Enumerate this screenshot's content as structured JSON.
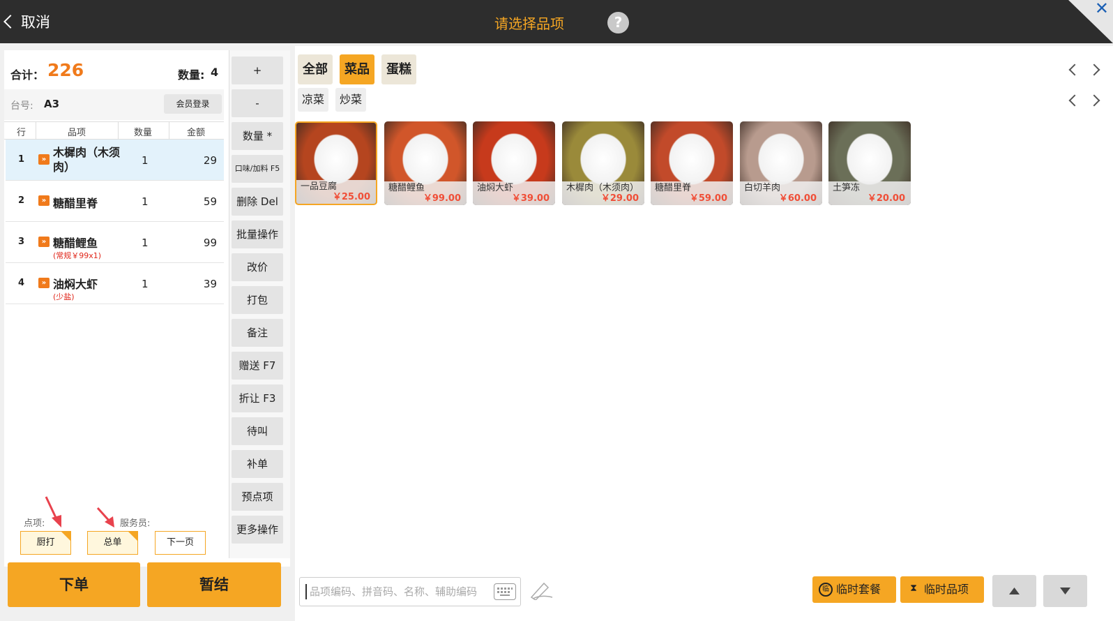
{
  "header": {
    "cancel_label": "取消",
    "title": "请选择品项",
    "help_label": "?",
    "close_label": "✕"
  },
  "summary": {
    "total_label": "合计：",
    "total_value": "226",
    "qty_label": "数量:",
    "qty_value": "4",
    "table_label": "台号:",
    "table_value": "A3",
    "member_login": "会员登录"
  },
  "order_columns": [
    "行",
    "品项",
    "数量",
    "金额"
  ],
  "order_rows": [
    {
      "idx": "1",
      "tag": "»",
      "name": "木樨肉（木须肉）",
      "note": "",
      "qty": "1",
      "amount": "29"
    },
    {
      "idx": "2",
      "tag": "»",
      "name": "糖醋里脊",
      "note": "",
      "qty": "1",
      "amount": "59"
    },
    {
      "idx": "3",
      "tag": "»",
      "name": "糖醋鲤鱼",
      "note": "(常规￥99x1)",
      "qty": "1",
      "amount": "99"
    },
    {
      "idx": "4",
      "tag": "»",
      "name": "油焖大虾",
      "note": "(少盐)",
      "qty": "1",
      "amount": "39"
    }
  ],
  "bottom": {
    "order_item_label": "点项:",
    "waiter_label": "服务员:",
    "kitchen_print": "厨打",
    "total_print": "总单",
    "next_page": "下一页",
    "submit": "下单",
    "hold": "暂结"
  },
  "operations": [
    "+",
    "-",
    "数量 *",
    "口味/加料 F5",
    "删除 Del",
    "批量操作",
    "改价",
    "打包",
    "备注",
    "赠送 F7",
    "折让 F3",
    "待叫",
    "补单",
    "预点项",
    "更多操作"
  ],
  "categories": [
    {
      "label": "全部",
      "active": false
    },
    {
      "label": "菜品",
      "active": true
    },
    {
      "label": "蛋糕",
      "active": false
    }
  ],
  "subcategories": [
    "凉菜",
    "炒菜"
  ],
  "dishes": [
    {
      "name": "一品豆腐",
      "price": "￥25.00",
      "color": "#b5451f"
    },
    {
      "name": "糖醋鲤鱼",
      "price": "￥99.00",
      "color": "#d1562a"
    },
    {
      "name": "油焖大虾",
      "price": "￥39.00",
      "color": "#c73a1c"
    },
    {
      "name": "木樨肉（木须肉）",
      "price": "￥29.00",
      "color": "#9a8a3a"
    },
    {
      "name": "糖醋里脊",
      "price": "￥59.00",
      "color": "#c24a2a"
    },
    {
      "name": "白切羊肉",
      "price": "￥60.00",
      "color": "#b89b8e"
    },
    {
      "name": "土笋冻",
      "price": "￥20.00",
      "color": "#6b6f58"
    }
  ],
  "search": {
    "placeholder": "品项编码、拼音码、名称、辅助编码"
  },
  "actions": {
    "temp_set_meal": "临时套餐",
    "temp_item": "临时品项"
  }
}
